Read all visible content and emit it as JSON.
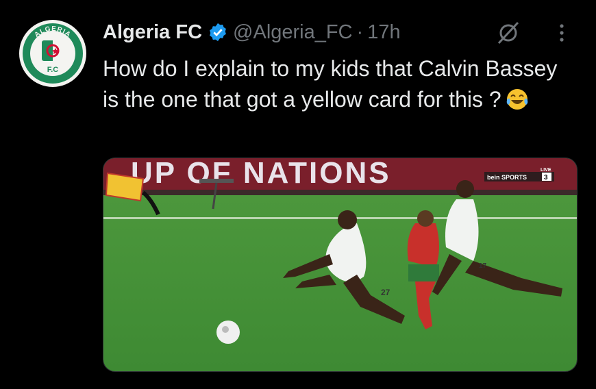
{
  "tweet": {
    "author_name": "Algeria FC",
    "handle": "@Algeria_FC",
    "separator": "·",
    "time": "17h",
    "text": "How do I explain to my kids that Calvin Bassey is the one that got a yellow card for this ?",
    "emoji": "face-with-tears-of-joy",
    "verified": true
  },
  "avatar": {
    "icon": "algeria-fc-logo",
    "logo_text": "ALGERIA",
    "logo_sub": "F.C"
  },
  "media": {
    "banner_text": "UP OF NATIONS",
    "broadcaster": "bein SPORTS",
    "channel": "3",
    "live_label": "LIVE",
    "player_number_1": "27",
    "player_number_2": "17"
  },
  "icons": {
    "grok": "grok-icon",
    "more": "more-options-icon",
    "verified": "verified-badge-icon"
  },
  "colors": {
    "background": "#000000",
    "text": "#e7e9ea",
    "muted": "#71767b",
    "verified": "#1d9bf0",
    "logo_green": "#1f8a5a"
  }
}
